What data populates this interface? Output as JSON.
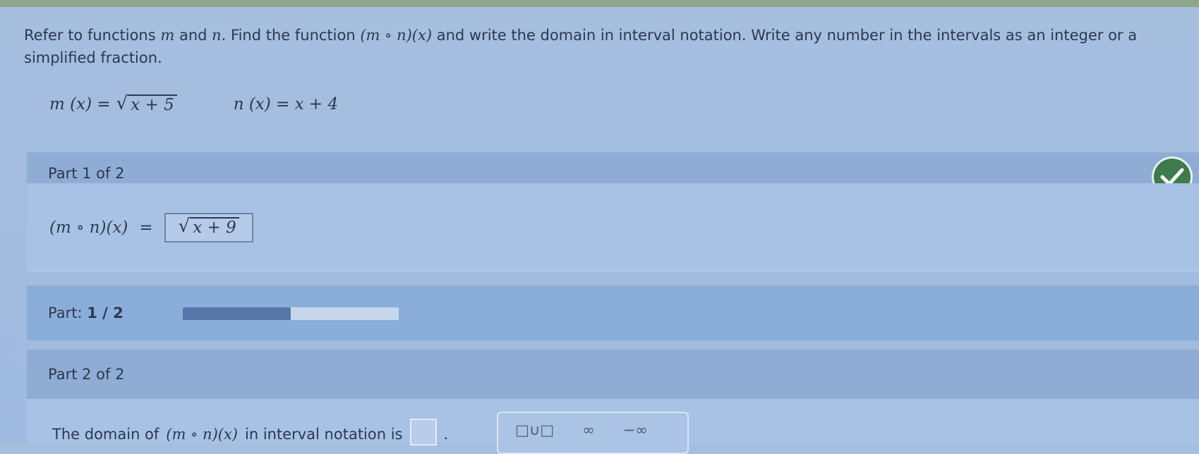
{
  "question": {
    "text_1": "Refer to functions ",
    "m": "m",
    "text_2": " and ",
    "n": "n",
    "text_3": ". Find the function ",
    "composition": "(m ∘ n)(x)",
    "text_4": " and write the domain in interval notation. Write any number in the intervals as an integer or a simplified fraction."
  },
  "functions": {
    "m_lhs": "m (x) =",
    "m_radicand": "x + 5",
    "n_def": "n (x) = x + 4"
  },
  "part1": {
    "header": "Part 1 of 2",
    "lhs": "(m  ∘  n)(x)",
    "equals": "=",
    "answer_radicand": "x + 9",
    "status": "correct"
  },
  "progress": {
    "label": "Part:",
    "value": "1 / 2",
    "fraction": 0.5
  },
  "part2": {
    "header": "Part 2 of 2",
    "prompt_1": "The domain of ",
    "composition": "(m ∘ n)(x)",
    "prompt_2": " in interval notation is",
    "period": ".",
    "palette": [
      "□∪□",
      "∞",
      "−∞"
    ]
  },
  "colors": {
    "check": "#3e7b4c",
    "progress_fill": "#5676a9"
  }
}
